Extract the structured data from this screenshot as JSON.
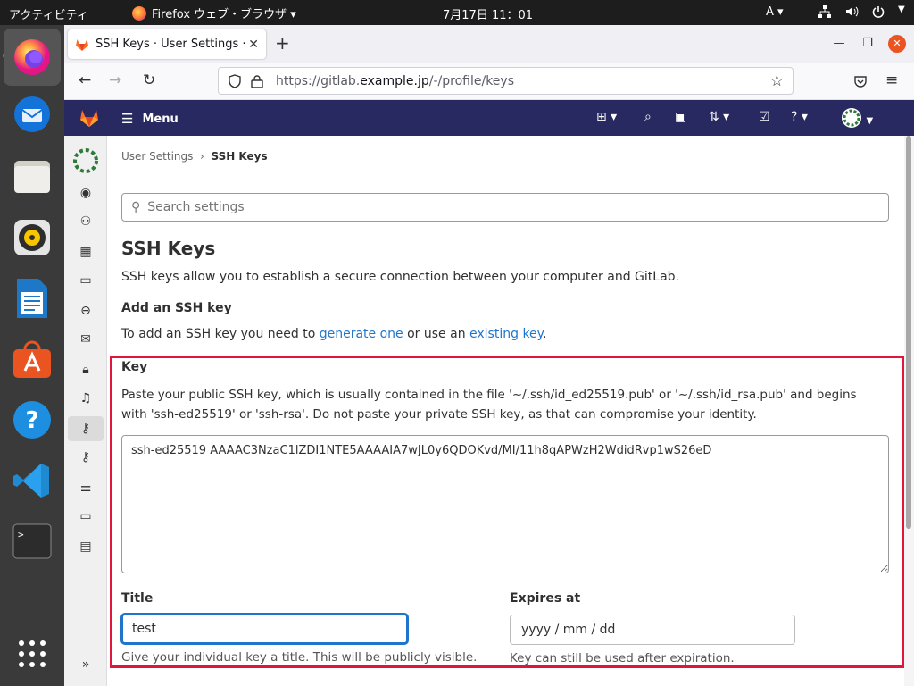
{
  "topbar": {
    "activities": "アクティビティ",
    "app_name": "Firefox ウェブ・ブラウザ ▾",
    "clock": "7月17日  11：01",
    "input_method": "A ▾"
  },
  "dock": {
    "apps": [
      "firefox-icon",
      "thunderbird-icon",
      "files-icon",
      "rhythmbox-icon",
      "writer-icon",
      "software-icon",
      "help-icon",
      "vscode-icon",
      "terminal-icon",
      "app-grid-icon"
    ]
  },
  "browser": {
    "tab_title": "SSH Keys · User Settings ·",
    "url_prefix": "https://gitlab.",
    "url_host": "example.jp",
    "url_path": "/-/profile/keys"
  },
  "gitlab": {
    "menu_label": "Menu",
    "breadcrumb": {
      "parent": "User Settings",
      "current": "SSH Keys"
    },
    "search_placeholder": "Search settings",
    "page_title": "SSH Keys",
    "intro": "SSH keys allow you to establish a secure connection between your computer and GitLab.",
    "add_heading": "Add an SSH key",
    "add_text_1": "To add an SSH key you need to ",
    "add_link_1": "generate one",
    "add_text_2": " or use an ",
    "add_link_2": "existing key",
    "add_text_3": ".",
    "key_label": "Key",
    "key_help": "Paste your public SSH key, which is usually contained in the file '~/.ssh/id_ed25519.pub' or '~/.ssh/id_rsa.pub' and begins with 'ssh-ed25519' or 'ssh-rsa'. Do not paste your private SSH key, as that can compromise your identity.",
    "key_value": "ssh-ed25519 AAAAC3NzaC1lZDI1NTE5AAAAIA7wJL0y6QDOKvd/MI/11h8qAPWzH2WdidRvp1wS26eD",
    "title_label": "Title",
    "title_value": "test",
    "title_help": "Give your individual key a title. This will be publicly visible.",
    "expires_label": "Expires at",
    "expires_placeholder": "yyyy / mm / dd",
    "expires_help": "Key can still be used after expiration."
  },
  "colors": {
    "gitlab_header": "#292961",
    "highlight_border": "#e0163d",
    "link": "#1f75cb",
    "ubuntu_accent": "#e95420"
  }
}
